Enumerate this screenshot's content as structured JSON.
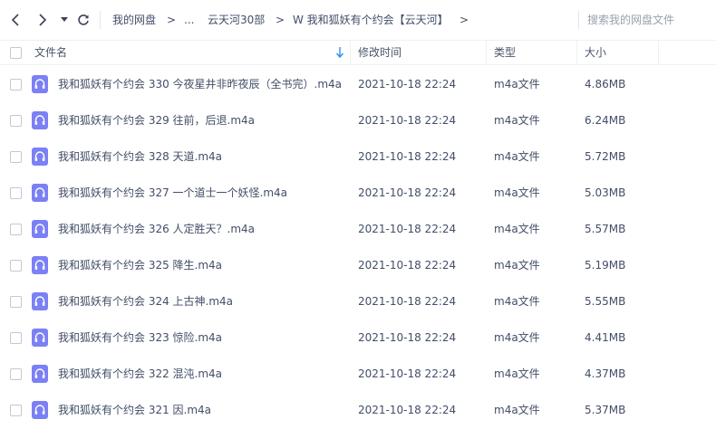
{
  "nav": {
    "breadcrumbs": [
      "我的网盘",
      "...",
      "云天河30部",
      "W 我和狐妖有个约会【云天河】"
    ],
    "separator": ">",
    "search_placeholder": "搜索我的网盘文件"
  },
  "table": {
    "columns": {
      "name": "文件名",
      "modified": "修改时间",
      "type": "类型",
      "size": "大小"
    },
    "sort_column": "name",
    "icon": "audio-file-icon",
    "icon_color": "#7b80f5",
    "rows": [
      {
        "name": "我和狐妖有个约会 330 今夜星井非昨夜辰（全书完）.m4a",
        "modified": "2021-10-18 22:24",
        "type": "m4a文件",
        "size": "4.86MB"
      },
      {
        "name": "我和狐妖有个约会 329 往前，后退.m4a",
        "modified": "2021-10-18 22:24",
        "type": "m4a文件",
        "size": "6.24MB"
      },
      {
        "name": "我和狐妖有个约会 328 天道.m4a",
        "modified": "2021-10-18 22:24",
        "type": "m4a文件",
        "size": "5.72MB"
      },
      {
        "name": "我和狐妖有个约会 327 一个道士一个妖怪.m4a",
        "modified": "2021-10-18 22:24",
        "type": "m4a文件",
        "size": "5.03MB"
      },
      {
        "name": "我和狐妖有个约会 326 人定胜天？.m4a",
        "modified": "2021-10-18 22:24",
        "type": "m4a文件",
        "size": "5.57MB"
      },
      {
        "name": "我和狐妖有个约会 325 降生.m4a",
        "modified": "2021-10-18 22:24",
        "type": "m4a文件",
        "size": "5.19MB"
      },
      {
        "name": "我和狐妖有个约会 324 上古神.m4a",
        "modified": "2021-10-18 22:24",
        "type": "m4a文件",
        "size": "5.55MB"
      },
      {
        "name": "我和狐妖有个约会 323 惊险.m4a",
        "modified": "2021-10-18 22:24",
        "type": "m4a文件",
        "size": "4.41MB"
      },
      {
        "name": "我和狐妖有个约会 322 混沌.m4a",
        "modified": "2021-10-18 22:24",
        "type": "m4a文件",
        "size": "4.37MB"
      },
      {
        "name": "我和狐妖有个约会 321 因.m4a",
        "modified": "2021-10-18 22:24",
        "type": "m4a文件",
        "size": "5.37MB"
      }
    ]
  }
}
